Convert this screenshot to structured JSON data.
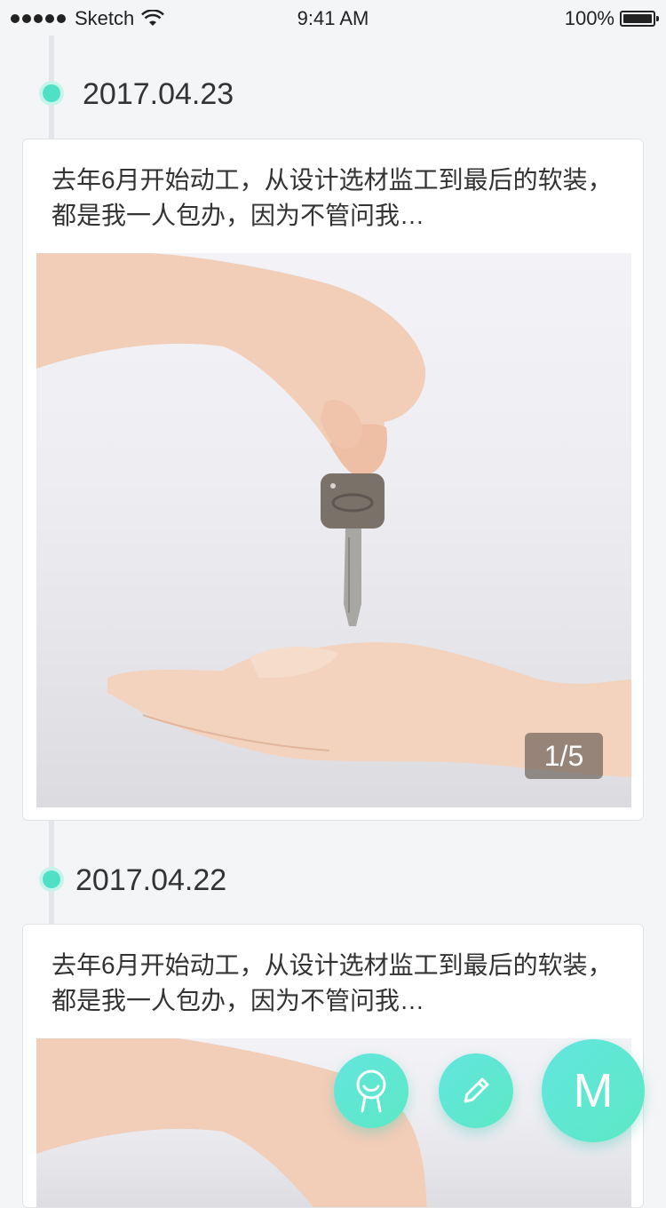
{
  "status_bar": {
    "carrier": "Sketch",
    "time": "9:41 AM",
    "battery": "100%",
    "signal_icon": "signal-dots-icon",
    "wifi_icon": "wifi-icon",
    "battery_icon": "battery-icon"
  },
  "timeline": {
    "entries": [
      {
        "date": "2017.04.23",
        "text": "去年6月开始动工，从设计选材监工到最后的软装，都是我一人包办，因为不管问我…",
        "photo_counter": "1/5"
      },
      {
        "date": "2017.04.22",
        "text": "去年6月开始动工，从设计选材监工到最后的软装，都是我一人包办，因为不管问我…"
      }
    ]
  },
  "fabs": {
    "profile_icon": "person-icon",
    "edit_icon": "pencil-icon",
    "menu_label": "M"
  },
  "colors": {
    "accent": "#4ee1c5",
    "fab_gradient_start": "#63e6df",
    "fab_gradient_end": "#5ce8c4",
    "background": "#f4f5f7"
  }
}
